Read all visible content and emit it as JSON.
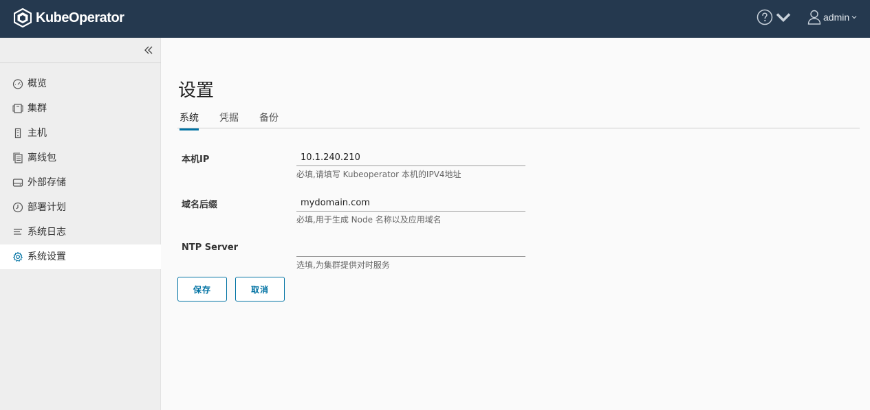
{
  "header": {
    "brand": "KubeOperator",
    "user": "admin"
  },
  "sidebar": {
    "items": [
      {
        "label": "概览",
        "icon": "dashboard-icon"
      },
      {
        "label": "集群",
        "icon": "cluster-icon"
      },
      {
        "label": "主机",
        "icon": "host-icon"
      },
      {
        "label": "离线包",
        "icon": "package-icon"
      },
      {
        "label": "外部存储",
        "icon": "storage-icon"
      },
      {
        "label": "部署计划",
        "icon": "clock-icon"
      },
      {
        "label": "系统日志",
        "icon": "log-icon"
      },
      {
        "label": "系统设置",
        "icon": "gear-icon"
      }
    ],
    "active_index": 7
  },
  "main": {
    "title": "设置",
    "tabs": [
      {
        "label": "系统"
      },
      {
        "label": "凭据"
      },
      {
        "label": "备份"
      }
    ],
    "active_tab": 0,
    "fields": [
      {
        "label": "本机IP",
        "value": "10.1.240.210",
        "help": "必填,请填写 Kubeoperator 本机的IPV4地址"
      },
      {
        "label": "域名后缀",
        "value": "mydomain.com",
        "help": "必填,用于生成 Node 名称以及应用域名"
      },
      {
        "label": "NTP Server",
        "value": "",
        "help": "选填,为集群提供对时服务"
      }
    ],
    "buttons": {
      "save": "保存",
      "cancel": "取消"
    }
  },
  "colors": {
    "header_bg": "#25394f",
    "accent": "#0072a3",
    "sidebar_bg": "#eeeeee"
  }
}
